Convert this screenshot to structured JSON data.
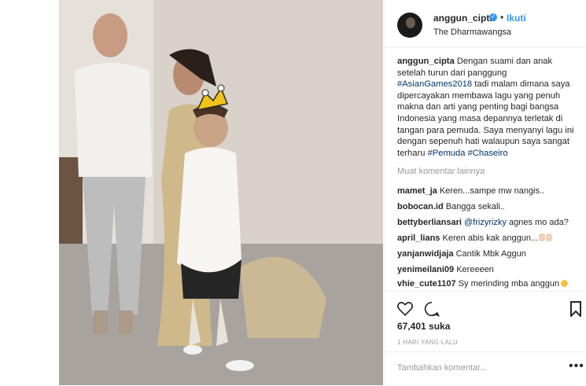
{
  "header": {
    "username": "anggun_cipta",
    "separator": "•",
    "follow_label": "Ikuti",
    "location": "The Dharmawangsa"
  },
  "caption": {
    "username": "anggun_cipta",
    "text_1": " Dengan suami dan anak setelah turun dari panggung ",
    "hashtag_1": "#AsianGames2018",
    "text_2": " tadi malam dimana saya dipercayakan membawa lagu yang penuh makna dan arti yang penting bagi bangsa Indonesia yang masa depannya terletak di tangan para pemuda. Saya menyanyi lagu ini dengan sepenuh hati walaupun saya sangat terharu ",
    "hashtag_2": "#Pemuda",
    "hashtag_3": "#Chaseiro"
  },
  "load_more_label": "Muat komentar lainnya",
  "comments": [
    {
      "user": "mamet_ja",
      "text": "Keren...sampe mw nangis.."
    },
    {
      "user": "bobocan.id",
      "text": "Bangga sekali.."
    },
    {
      "user": "bettyberliansari",
      "mention": "@frizyrizky",
      "text": " agnes mo ada?"
    },
    {
      "user": "april_lians",
      "text": "Keren abis kak anggun..."
    },
    {
      "user": "yanjanwidjaja",
      "text": "Cantik Mbk Aggun"
    },
    {
      "user": "yenimeilani09",
      "text": "Kereeeen"
    },
    {
      "user": "vhie_cute1107",
      "text": "Sy merinding mba anggun"
    }
  ],
  "likes_label": "67,401 suka",
  "time_label": "1 HARI YANG LALU",
  "add_comment_placeholder": "Tambahkan komentar...",
  "more_options_label": "•••",
  "icons": [
    "heart-icon",
    "comment-icon",
    "bookmark-icon",
    "verified-badge-icon"
  ],
  "colors": {
    "accent": "#3897f0",
    "hashtag": "#003569",
    "muted": "#999999"
  }
}
